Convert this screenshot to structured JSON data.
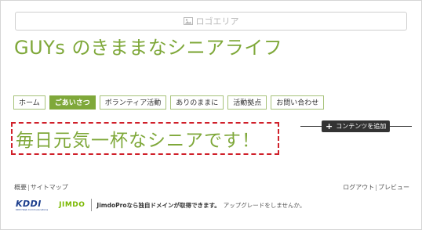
{
  "header": {
    "logo_area_label": "ロゴエリア",
    "site_title": "GUYs のきままなシニアライフ"
  },
  "nav": {
    "items": [
      {
        "label": "ホーム",
        "active": false
      },
      {
        "label": "ごあいさつ",
        "active": true
      },
      {
        "label": "ボランティア活動",
        "active": false
      },
      {
        "label": "ありのままに",
        "active": false
      },
      {
        "label": "活動拠点",
        "active": false
      },
      {
        "label": "お問い合わせ",
        "active": false
      }
    ]
  },
  "main": {
    "headline": "毎日元気一杯なシニアです！",
    "add_content_label": "コンテンツを追加"
  },
  "footer": {
    "overview": "概要",
    "sitemap": "サイトマップ",
    "logout": "ログアウト",
    "preview": "プレビュー",
    "kddi_logo": "KDDI",
    "kddi_sub": "KDDI Web Communications",
    "jimdo_logo": "JIMDO",
    "promo_bold": "JimdoProなら独自ドメインが取得できます。",
    "promo_upgrade": "アップグレードをしませんか。"
  },
  "colors": {
    "accent": "#7fa83a",
    "dashed_border": "#d0202a",
    "dark_button": "#333333",
    "kddi_blue": "#1a3c8c"
  }
}
